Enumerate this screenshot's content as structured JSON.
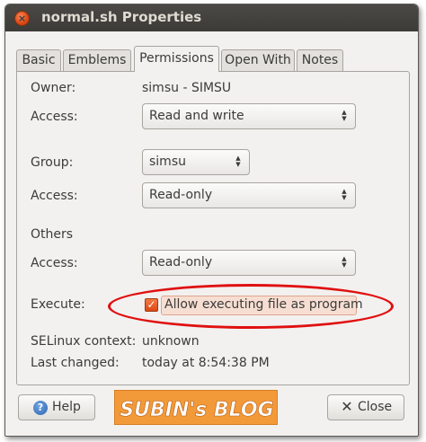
{
  "window": {
    "title": "normal.sh Properties",
    "close_glyph": "×"
  },
  "tabs": [
    {
      "label": "Basic",
      "active": false
    },
    {
      "label": "Emblems",
      "active": false
    },
    {
      "label": "Permissions",
      "active": true
    },
    {
      "label": "Open With",
      "active": false
    },
    {
      "label": "Notes",
      "active": false
    }
  ],
  "permissions": {
    "owner_label": "Owner:",
    "owner_value": "simsu - SIMSU",
    "owner_access_label": "Access:",
    "owner_access_value": "Read and write",
    "group_label": "Group:",
    "group_value": "simsu",
    "group_access_label": "Access:",
    "group_access_value": "Read-only",
    "others_label": "Others",
    "others_access_label": "Access:",
    "others_access_value": "Read-only",
    "execute_label": "Execute:",
    "execute_checkbox_label": "Allow executing file as program",
    "execute_checked": true,
    "selinux_label": "SELinux context:",
    "selinux_value": "unknown",
    "last_changed_label": "Last changed:",
    "last_changed_value": "today at 8:54:38 PM"
  },
  "buttons": {
    "help_label": "Help",
    "help_icon_glyph": "?",
    "close_label": "Close",
    "close_icon_glyph": "✕"
  },
  "watermark": {
    "logo_text": "SUBIN's BLOG"
  },
  "icons": {
    "window_close": "window-close-icon",
    "help": "help-icon",
    "close": "close-icon",
    "combo": "combo-arrows-icon",
    "check": "checkmark-icon"
  },
  "colors": {
    "accent": "#dd4814",
    "titlebar": "#3c3b37",
    "annotation": "#e01010",
    "logo_bg": "#f29a3a"
  }
}
